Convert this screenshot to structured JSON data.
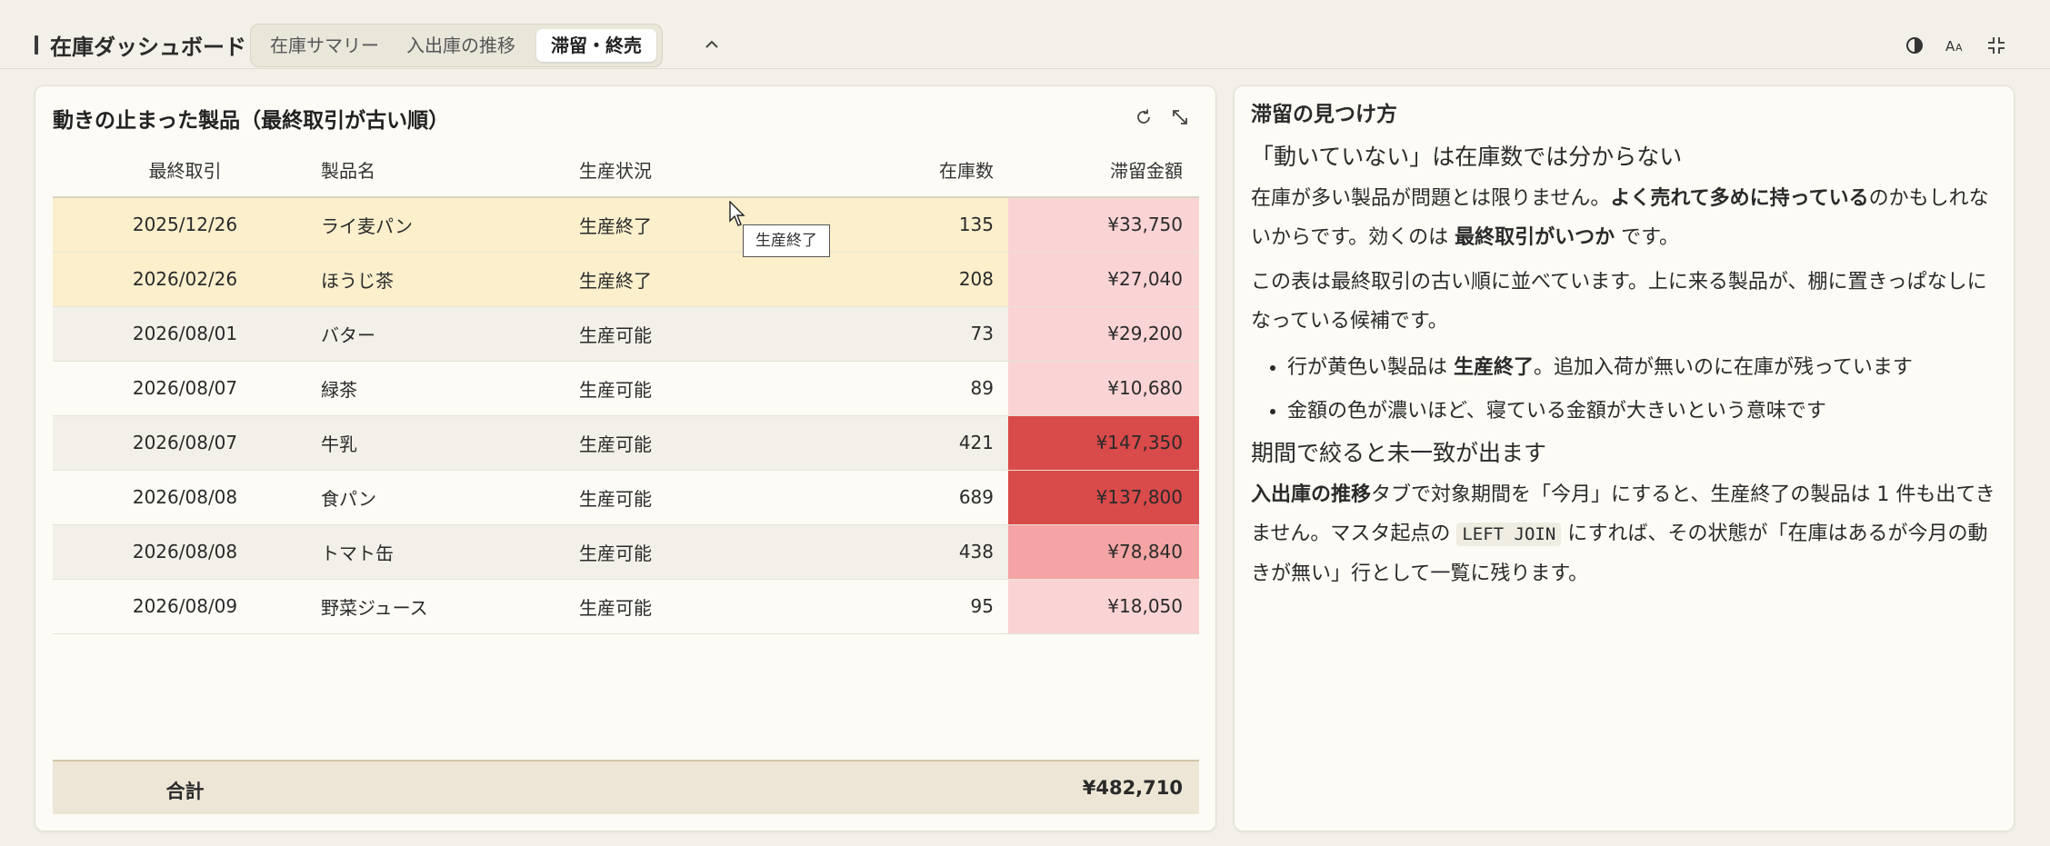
{
  "app": {
    "title": "在庫ダッシュボード",
    "tabs": [
      {
        "label": "在庫サマリー",
        "active": false
      },
      {
        "label": "入出庫の推移",
        "active": false
      },
      {
        "label": "滞留・終売",
        "active": true
      }
    ],
    "header_icons": [
      "collapse-chevron-up-icon",
      "contrast-icon",
      "font-size-icon",
      "fullscreen-exit-icon"
    ]
  },
  "left_panel": {
    "title": "動きの止まった製品（最終取引が古い順）",
    "icons": [
      "refresh-icon",
      "expand-icon"
    ],
    "columns": [
      "最終取引",
      "製品名",
      "生産状況",
      "在庫数",
      "滞留金額"
    ],
    "rows": [
      {
        "date": "2025/12/26",
        "name": "ライ麦パン",
        "status": "生産終了",
        "qty": "135",
        "amount": "¥33,750",
        "discontinued": true,
        "heat": 1
      },
      {
        "date": "2026/02/26",
        "name": "ほうじ茶",
        "status": "生産終了",
        "qty": "208",
        "amount": "¥27,040",
        "discontinued": true,
        "heat": 1
      },
      {
        "date": "2026/08/01",
        "name": "バター",
        "status": "生産可能",
        "qty": "73",
        "amount": "¥29,200",
        "discontinued": false,
        "heat": 1
      },
      {
        "date": "2026/08/07",
        "name": "緑茶",
        "status": "生産可能",
        "qty": "89",
        "amount": "¥10,680",
        "discontinued": false,
        "heat": 1
      },
      {
        "date": "2026/08/07",
        "name": "牛乳",
        "status": "生産可能",
        "qty": "421",
        "amount": "¥147,350",
        "discontinued": false,
        "heat": 3
      },
      {
        "date": "2026/08/08",
        "name": "食パン",
        "status": "生産可能",
        "qty": "689",
        "amount": "¥137,800",
        "discontinued": false,
        "heat": 3
      },
      {
        "date": "2026/08/08",
        "name": "トマト缶",
        "status": "生産可能",
        "qty": "438",
        "amount": "¥78,840",
        "discontinued": false,
        "heat": 2
      },
      {
        "date": "2026/08/09",
        "name": "野菜ジュース",
        "status": "生産可能",
        "qty": "95",
        "amount": "¥18,050",
        "discontinued": false,
        "heat": 1
      }
    ],
    "total": {
      "label": "合計",
      "value": "¥482,710"
    },
    "tooltip": "生産終了",
    "colors": {
      "discontinued_row": "#fbefcc",
      "heat1": "#fad4d4",
      "heat2": "#f4a4a4",
      "heat3": "#d94a4a"
    }
  },
  "right_panel": {
    "title": "滞留の見つけ方",
    "h1": "「動いていない」は在庫数では分からない",
    "p1": {
      "a": "在庫が多い製品が問題とは限りません。",
      "b1": "よく売れて多めに持っている",
      "c": "のかもしれないからです。効くのは ",
      "b2": "最終取引がいつか",
      "d": " です。"
    },
    "p2": "この表は最終取引の古い順に並べています。上に来る製品が、棚に置きっぱなしになっている候補です。",
    "bullets": [
      {
        "a": "行が黄色い製品は ",
        "b": "生産終了",
        "c": "。追加入荷が無いのに在庫が残っています"
      },
      {
        "a": "金額の色が濃いほど、寝ている金額が大きいという意味です",
        "b": "",
        "c": ""
      }
    ],
    "h2": "期間で絞ると未一致が出ます",
    "p3": {
      "b": "入出庫の推移",
      "a": "タブで対象期間を「今月」にすると、生産終了の製品は 1 件も出てきません。マスタ起点の ",
      "code": "LEFT JOIN",
      "c": " にすれば、その状態が「在庫はあるが今月の動きが無い」行として一覧に残ります。"
    }
  }
}
